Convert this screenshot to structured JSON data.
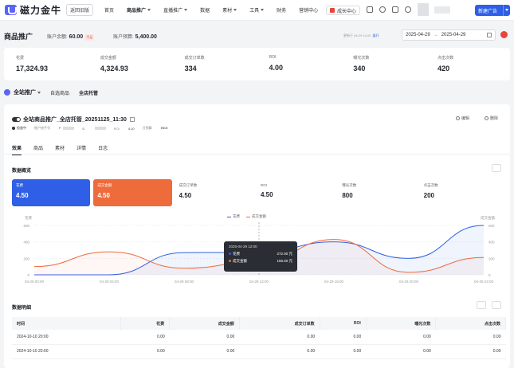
{
  "app": {
    "logo_text": "磁力金牛",
    "old_version_label": "返回旧版"
  },
  "nav": [
    {
      "label": "首页",
      "active": false,
      "dropdown": false
    },
    {
      "label": "商品推广",
      "active": true,
      "dropdown": true
    },
    {
      "label": "直播推广",
      "active": false,
      "dropdown": true
    },
    {
      "label": "数据",
      "active": false,
      "dropdown": false
    },
    {
      "label": "素材",
      "active": false,
      "dropdown": true
    },
    {
      "label": "工具",
      "active": false,
      "dropdown": true
    },
    {
      "label": "财务",
      "active": false,
      "dropdown": false
    },
    {
      "label": "营销中心",
      "active": false,
      "dropdown": false
    }
  ],
  "topbar": {
    "growth_label": "成长中心",
    "new_ad_label": "新建广告"
  },
  "page": {
    "title": "商品推广",
    "balance_label": "账户余额:",
    "balance_value": "60.00",
    "charge_tag": "不足",
    "budget_label": "账户预算:",
    "budget_value": "5,400.00",
    "update_text": "更新于 04-29 14:20",
    "expand_label": "展开",
    "date_start": "2025-04-29",
    "date_end": "2025-04-29",
    "date_arrow": "→"
  },
  "kpis": [
    {
      "label": "花费",
      "value": "17,324.93"
    },
    {
      "label": "成交金额",
      "value": "4,324.93"
    },
    {
      "label": "成交订单数",
      "value": "334"
    },
    {
      "label": "ROI",
      "value": "4.00"
    },
    {
      "label": "曝光次数",
      "value": "340"
    },
    {
      "label": "点击次数",
      "value": "420"
    }
  ],
  "subtabs": {
    "main": "全站推广",
    "items": [
      {
        "label": "自选商品",
        "active": false
      },
      {
        "label": "全店托管",
        "active": true
      }
    ]
  },
  "campaign": {
    "title": "全站商品推广_全店托管_20251125_11:30",
    "status": "投放中",
    "account_label": "账户快手号",
    "account_value": "F",
    "id_label": "ID",
    "roi_label": "ROI",
    "roi_value": "4.10",
    "budget_label": "日预算",
    "budget_value": "¥500",
    "edit_label": "编辑",
    "delete_label": "删除"
  },
  "panel_tabs": [
    {
      "label": "效果",
      "active": true
    },
    {
      "label": "商品",
      "active": false
    },
    {
      "label": "素材",
      "active": false
    },
    {
      "label": "详情",
      "active": false
    },
    {
      "label": "日志",
      "active": false
    }
  ],
  "overview": {
    "title": "数据概览"
  },
  "metric_cards": [
    {
      "label": "花费",
      "value": "4.50",
      "style": "blue"
    },
    {
      "label": "成交金额",
      "value": "4.50",
      "style": "orange"
    },
    {
      "label": "成交订单数",
      "value": "4.50",
      "style": "plain"
    },
    {
      "label": "ROI",
      "value": "4.50",
      "style": "plain"
    },
    {
      "label": "曝光次数",
      "value": "800",
      "style": "plain"
    },
    {
      "label": "点击次数",
      "value": "200",
      "style": "plain"
    }
  ],
  "tooltip": {
    "time": "2025-04-29 12:00",
    "rows": [
      {
        "name": "花费",
        "value": "272.90",
        "unit": "元",
        "color": "#2e5fe6"
      },
      {
        "name": "成交金额",
        "value": "156.50",
        "unit": "元",
        "color": "#ee6b3c"
      }
    ]
  },
  "chart_data": {
    "type": "line",
    "left_axis_label": "花费",
    "right_axis_label": "成交金额",
    "ylim_left": [
      0,
      600
    ],
    "ylim_right": [
      0,
      600
    ],
    "y_ticks": [
      "0",
      "200",
      "400",
      "600"
    ],
    "x": [
      "04-29 00:00",
      "04-29 04:00",
      "04-29 08:00",
      "04-29 12:00",
      "04-29 16:00",
      "04-29 20:00",
      "04-29 24:00"
    ],
    "series": [
      {
        "name": "花费",
        "color": "#2e5fe6",
        "values": [
          0,
          0,
          270,
          273,
          400,
          200,
          600
        ]
      },
      {
        "name": "成交金额",
        "color": "#ee6b3c",
        "values": [
          100,
          280,
          80,
          160,
          430,
          30,
          210
        ]
      }
    ],
    "legend_position": "top-center",
    "grid": true
  },
  "detail": {
    "title": "数据明细",
    "columns": [
      "时间",
      "花费",
      "成交金额",
      "成交订单数",
      "ROI",
      "曝光次数",
      "点击次数"
    ],
    "rows": [
      [
        "2024-10-10 20:00",
        "0.00",
        "0.00",
        "0.00",
        "0.00",
        "0.00",
        "0.00"
      ],
      [
        "2024-10-10 20:00",
        "0.00",
        "0.00",
        "0.00",
        "0.00",
        "0.00",
        "0.00"
      ]
    ]
  }
}
